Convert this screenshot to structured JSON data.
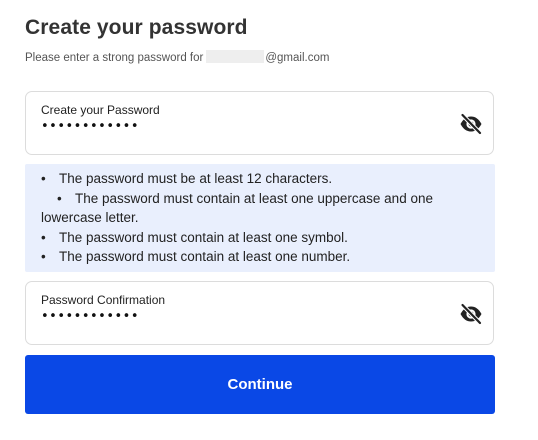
{
  "header": {
    "title": "Create your password",
    "subtitle_prefix": "Please enter a strong password for",
    "subtitle_suffix": "@gmail.com"
  },
  "password_field": {
    "label": "Create your Password",
    "value": "••••••••••••",
    "toggle_icon": "eye-slash-icon"
  },
  "requirements": {
    "items": [
      "The password must be at least 12 characters.",
      "The password must contain at least one uppercase and one lowercase letter.",
      "The password must contain at least one symbol.",
      "The password must contain at least one number."
    ],
    "background_color": "#e9effd"
  },
  "confirm_field": {
    "label": "Password Confirmation",
    "value": "••••••••••••",
    "toggle_icon": "eye-slash-icon"
  },
  "continue_button": {
    "label": "Continue",
    "color": "#0a48e6"
  }
}
